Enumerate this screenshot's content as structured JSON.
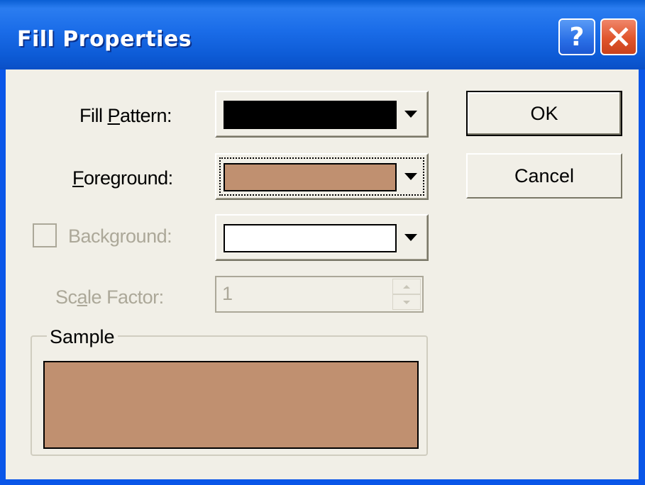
{
  "window": {
    "title": "Fill Properties",
    "help_glyph": "?",
    "close_glyph": "close-icon"
  },
  "fields": {
    "fill_pattern_label_pre": "Fill ",
    "fill_pattern_label_u": "P",
    "fill_pattern_label_post": "attern:",
    "fill_pattern_color": "#000000",
    "foreground_label_u": "F",
    "foreground_label_post": "oreground:",
    "foreground_color": "#c09070",
    "background_label": "Background:",
    "background_color": "#ffffff",
    "scale_label_pre": "Sc",
    "scale_label_u": "a",
    "scale_label_post": "le Factor:",
    "scale_value": "1"
  },
  "buttons": {
    "ok": "OK",
    "cancel": "Cancel"
  },
  "sample": {
    "title": "Sample",
    "color": "#c09070"
  },
  "colors": {
    "title_blue": "#0a56e8",
    "dialog_bg": "#f1efe7",
    "disabled_text": "#aca899"
  }
}
